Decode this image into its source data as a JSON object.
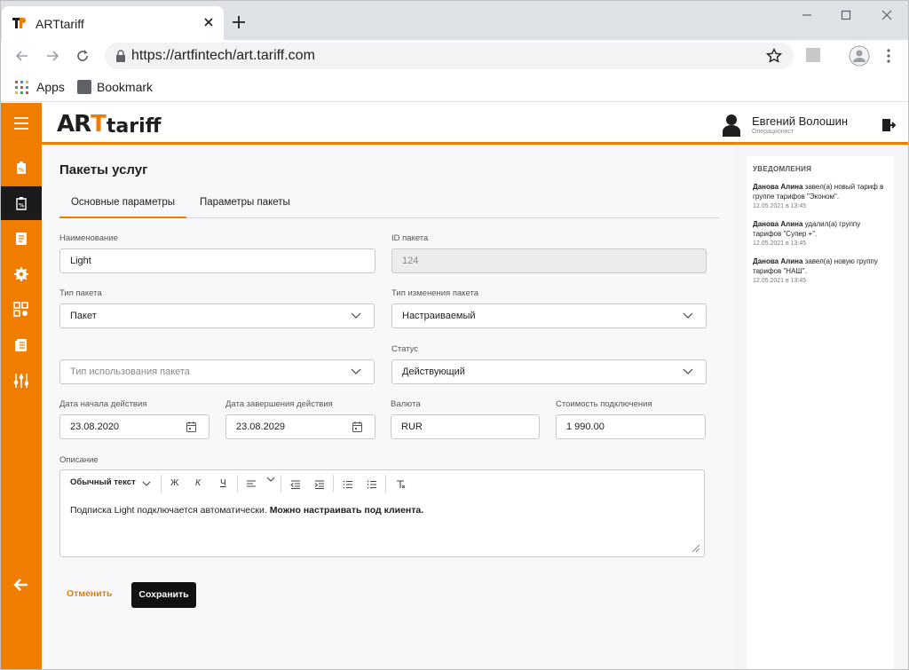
{
  "browser": {
    "tab_title": "ARTtariff",
    "url": "https://artfintech/art.tariff.com",
    "bookmarks": {
      "apps": "Apps",
      "bookmark": "Bookmark"
    }
  },
  "colors": {
    "accent": "#f07c00",
    "dark": "#1b1b1b",
    "sidebar_active": "#1b1b1b"
  },
  "header": {
    "logo_text_1": "AR",
    "logo_text_2": "T",
    "logo_text_3": "tariff",
    "user_name": "Евгений Волошин",
    "user_role": "Операционист"
  },
  "sidebar": {
    "items": [
      {
        "icon": "menu-icon",
        "active": false
      },
      {
        "icon": "tariff-tag-icon",
        "active": false
      },
      {
        "icon": "package-tag-icon",
        "active": true
      },
      {
        "icon": "document-list-icon",
        "active": false
      },
      {
        "icon": "settings-gear-icon",
        "active": false
      },
      {
        "icon": "grid-settings-icon",
        "active": false
      },
      {
        "icon": "notebook-icon",
        "active": false
      },
      {
        "icon": "sliders-icon",
        "active": false
      },
      {
        "icon": "back-arrow-icon",
        "active": false
      }
    ]
  },
  "page": {
    "title": "Пакеты услуг",
    "tabs": [
      {
        "label": "Основные параметры",
        "active": true
      },
      {
        "label": "Параметры пакеты",
        "active": false
      }
    ]
  },
  "form": {
    "name": {
      "label": "Наименование",
      "value": "Light"
    },
    "package_id": {
      "label": "ID пакета",
      "value": "124"
    },
    "package_type": {
      "label": "Тип пакета",
      "value": "Пакет"
    },
    "change_type": {
      "label": "Тип изменения пакета",
      "value": "Настраиваемый"
    },
    "usage_type": {
      "placeholder": "Тип использования пакета"
    },
    "status": {
      "label": "Статус",
      "value": "Действующий"
    },
    "start_date": {
      "label": "Дата начала действия",
      "value": "23.08.2020"
    },
    "end_date": {
      "label": "Дата завершения действия",
      "value": "23.08.2029"
    },
    "currency": {
      "label": "Валюта",
      "value": "RUR"
    },
    "connection_cost": {
      "label": "Стоимость подключения",
      "value": "1 990.00"
    },
    "description": {
      "label": "Описание",
      "style_select": "Обычный текст",
      "bold_button": "Ж",
      "italic_button": "К",
      "underline_button": "Ч",
      "text_plain": "Подписка Light подключается автоматически. ",
      "text_bold": "Можно настраивать под клиента."
    }
  },
  "actions": {
    "cancel": "Отменить",
    "save": "Сохранить"
  },
  "notifications": {
    "title": "УВЕДОМЛЕНИЯ",
    "items": [
      {
        "author": "Данова Алина",
        "text": " завел(а) новый тариф в группе тарифов \"Эконом\".",
        "date": "12.05.2021 в 13:45"
      },
      {
        "author": "Данова Алина",
        "text": " удалил(а) группу тарифов \"Супер +\".",
        "date": "12.05.2021 в 13:45"
      },
      {
        "author": "Данова Алина",
        "text": " завел(а) новую группу тарифов \"НАШ\".",
        "date": "12.05.2021 в 13:45"
      }
    ]
  }
}
